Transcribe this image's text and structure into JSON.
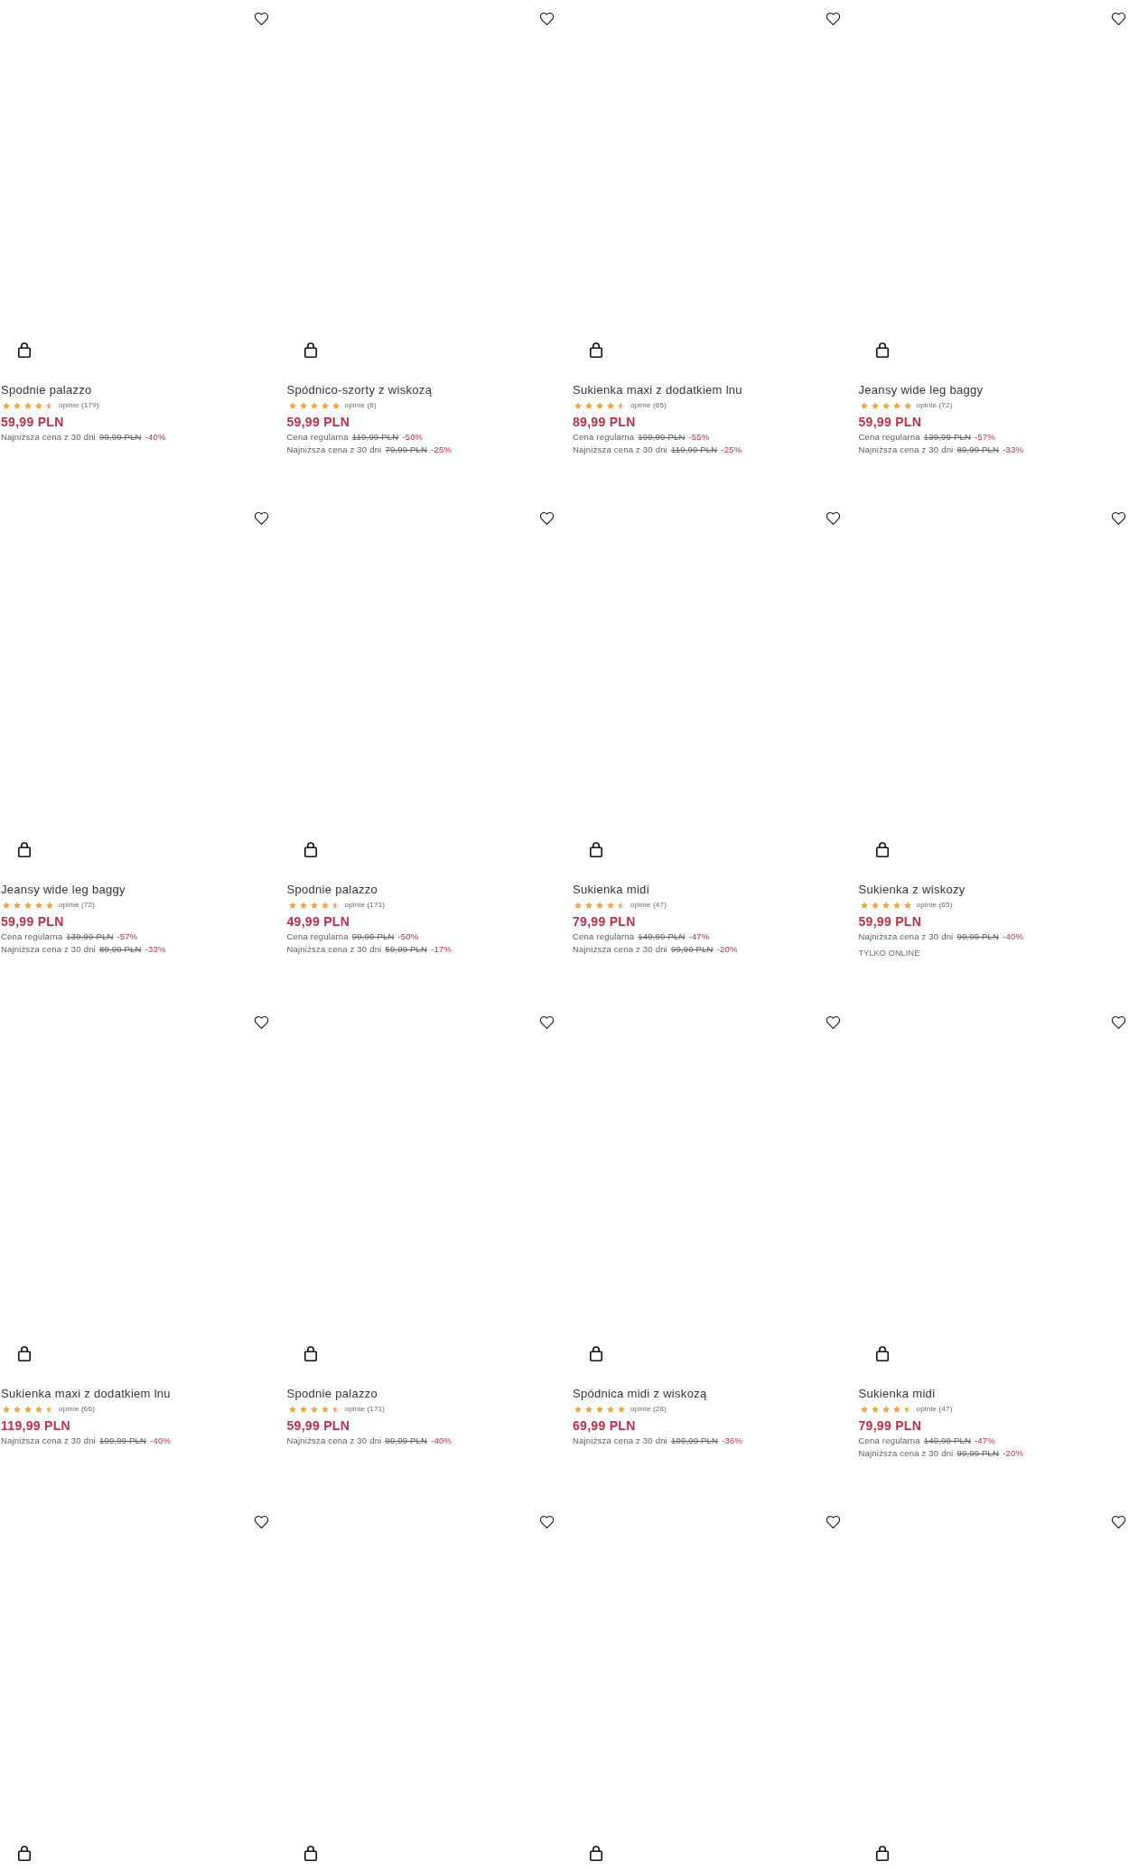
{
  "products": [
    {
      "wishlisted": false,
      "title": "Spodnie palazzo",
      "stars": 4.5,
      "reviews": "opinie (179)",
      "price": "59,99 PLN",
      "price_notes": [
        {
          "label": "Najniższa cena z 30 dni",
          "old_price": "99,99 PLN",
          "discount": "-40%"
        }
      ]
    },
    {
      "wishlisted": false,
      "title": "Spódnico-szorty z wiskozą",
      "stars": 5,
      "reviews": "opinie (6)",
      "price": "59,99 PLN",
      "price_notes": [
        {
          "label": "Cena regularna",
          "old_price": "119,99 PLN",
          "discount": "-50%"
        },
        {
          "label": "Najniższa cena z 30 dni",
          "old_price": "79,99 PLN",
          "discount": "-25%"
        }
      ]
    },
    {
      "wishlisted": false,
      "title": "Sukienka maxi z dodatkiem lnu",
      "stars": 4.5,
      "reviews": "opinie (65)",
      "price": "89,99 PLN",
      "price_notes": [
        {
          "label": "Cena regularna",
          "old_price": "199,99 PLN",
          "discount": "-55%"
        },
        {
          "label": "Najniższa cena z 30 dni",
          "old_price": "119,99 PLN",
          "discount": "-25%"
        }
      ]
    },
    {
      "wishlisted": false,
      "title": "Jeansy wide leg baggy",
      "stars": 5,
      "reviews": "opinie (72)",
      "price": "59,99 PLN",
      "price_notes": [
        {
          "label": "Cena regularna",
          "old_price": "139,99 PLN",
          "discount": "-57%"
        },
        {
          "label": "Najniższa cena z 30 dni",
          "old_price": "89,99 PLN",
          "discount": "-33%"
        }
      ]
    },
    {
      "wishlisted": false,
      "title": "Jeansy wide leg baggy",
      "stars": 5,
      "reviews": "opinie (72)",
      "price": "59,99 PLN",
      "price_notes": [
        {
          "label": "Cena regularna",
          "old_price": "139,99 PLN",
          "discount": "-57%"
        },
        {
          "label": "Najniższa cena z 30 dni",
          "old_price": "89,99 PLN",
          "discount": "-33%"
        }
      ]
    },
    {
      "wishlisted": false,
      "title": "Spodnie palazzo",
      "stars": 4.5,
      "reviews": "opinie (171)",
      "price": "49,99 PLN",
      "price_notes": [
        {
          "label": "Cena regularna",
          "old_price": "99,99 PLN",
          "discount": "-50%"
        },
        {
          "label": "Najniższa cena z 30 dni",
          "old_price": "59,99 PLN",
          "discount": "-17%"
        }
      ]
    },
    {
      "wishlisted": false,
      "title": "Sukienka midi",
      "stars": 4.5,
      "reviews": "opinie (47)",
      "price": "79,99 PLN",
      "price_notes": [
        {
          "label": "Cena regularna",
          "old_price": "149,99 PLN",
          "discount": "-47%"
        },
        {
          "label": "Najniższa cena z 30 dni",
          "old_price": "99,99 PLN",
          "discount": "-20%"
        }
      ]
    },
    {
      "wishlisted": false,
      "title": "Sukienka z wiskozy",
      "stars": 5,
      "reviews": "opinie (65)",
      "price": "59,99 PLN",
      "price_notes": [
        {
          "label": "Najniższa cena z 30 dni",
          "old_price": "99,99 PLN",
          "discount": "-40%"
        }
      ],
      "tag": "TYLKO ONLINE"
    },
    {
      "wishlisted": false,
      "title": "Sukienka maxi z dodatkiem lnu",
      "stars": 4.5,
      "reviews": "opinie (66)",
      "price": "119,99 PLN",
      "price_notes": [
        {
          "label": "Najniższa cena z 30 dni",
          "old_price": "199,99 PLN",
          "discount": "-40%"
        }
      ]
    },
    {
      "wishlisted": false,
      "title": "Spodnie palazzo",
      "stars": 4.5,
      "reviews": "opinie (171)",
      "price": "59,99 PLN",
      "price_notes": [
        {
          "label": "Najniższa cena z 30 dni",
          "old_price": "99,99 PLN",
          "discount": "-40%"
        }
      ]
    },
    {
      "wishlisted": false,
      "title": "Spódnica midi z wiskozą",
      "stars": 5,
      "reviews": "opinie (28)",
      "price": "69,99 PLN",
      "price_notes": [
        {
          "label": "Najniższa cena z 30 dni",
          "old_price": "109,99 PLN",
          "discount": "-36%"
        }
      ]
    },
    {
      "wishlisted": false,
      "title": "Sukienka midi",
      "stars": 4.5,
      "reviews": "opinie (47)",
      "price": "79,99 PLN",
      "price_notes": [
        {
          "label": "Cena regularna",
          "old_price": "149,99 PLN",
          "discount": "-47%"
        },
        {
          "label": "Najniższa cena z 30 dni",
          "old_price": "99,99 PLN",
          "discount": "-20%"
        }
      ]
    },
    {
      "wishlisted": false
    },
    {
      "wishlisted": false
    },
    {
      "wishlisted": false
    },
    {
      "wishlisted": false
    }
  ]
}
